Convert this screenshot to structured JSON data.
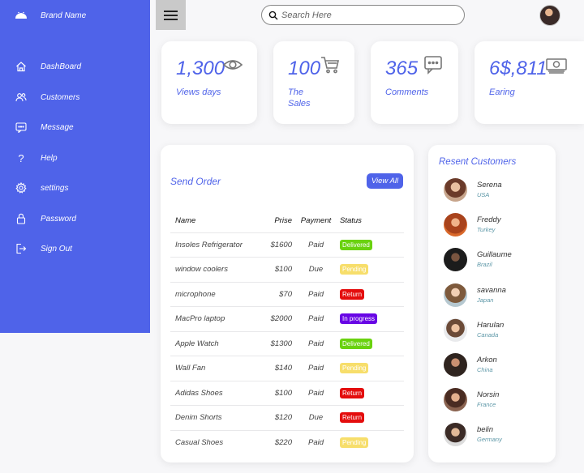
{
  "brand": {
    "name": "Brand Name"
  },
  "sidebar": {
    "items": [
      {
        "label": "DashBoard",
        "icon": "home-icon"
      },
      {
        "label": "Customers",
        "icon": "users-icon"
      },
      {
        "label": "Message",
        "icon": "message-icon"
      },
      {
        "label": "Help",
        "icon": "help-icon"
      },
      {
        "label": "settings",
        "icon": "gear-icon"
      },
      {
        "label": "Password",
        "icon": "lock-icon"
      },
      {
        "label": "Sign Out",
        "icon": "sign-out-icon"
      }
    ]
  },
  "search": {
    "placeholder": "Search Here",
    "value": ""
  },
  "stats": [
    {
      "value": "1,300",
      "label": "Views days",
      "icon": "eye-icon"
    },
    {
      "value": "100",
      "label": "The Sales",
      "icon": "cart-icon"
    },
    {
      "value": "365",
      "label": "Comments",
      "icon": "comment-icon"
    },
    {
      "value": "6$,811",
      "label": "Earing",
      "icon": "money-icon"
    }
  ],
  "orders": {
    "title": "Send Order",
    "view_all": "View All",
    "headers": {
      "name": "Name",
      "price": "Prise",
      "payment": "Payment",
      "status": "Status"
    },
    "rows": [
      {
        "name": "Insoles Refrigerator",
        "price": "$1600",
        "payment": "Paid",
        "status": "Delivered"
      },
      {
        "name": "window coolers",
        "price": "$100",
        "payment": "Due",
        "status": "Pending"
      },
      {
        "name": "microphone",
        "price": "$70",
        "payment": "Paid",
        "status": "Return"
      },
      {
        "name": "MacPro laptop",
        "price": "$2000",
        "payment": "Paid",
        "status": "In progress"
      },
      {
        "name": "Apple Watch",
        "price": "$1300",
        "payment": "Paid",
        "status": "Delivered"
      },
      {
        "name": "Wall Fan",
        "price": "$140",
        "payment": "Paid",
        "status": "Pending"
      },
      {
        "name": "Adidas Shoes",
        "price": "$100",
        "payment": "Paid",
        "status": "Return"
      },
      {
        "name": "Denim Shorts",
        "price": "$120",
        "payment": "Due",
        "status": "Return"
      },
      {
        "name": "Casual Shoes",
        "price": "$220",
        "payment": "Paid",
        "status": "Pending"
      }
    ]
  },
  "customers": {
    "title": "Resent Customers",
    "list": [
      {
        "name": "Serena",
        "country": "USA"
      },
      {
        "name": "Freddy",
        "country": "Turkey"
      },
      {
        "name": "Guillaume",
        "country": "Brazil"
      },
      {
        "name": "savanna",
        "country": "Japan"
      },
      {
        "name": "Harulan",
        "country": "Canada"
      },
      {
        "name": "Arkon",
        "country": "China"
      },
      {
        "name": "Norsin",
        "country": "France"
      },
      {
        "name": "belin",
        "country": "Germany"
      }
    ]
  },
  "colors": {
    "accent": "#4f63e9",
    "delivered": "#6ad20f",
    "pending": "#f7de6b",
    "return": "#e40d0d",
    "in_progress": "#6806e5"
  }
}
